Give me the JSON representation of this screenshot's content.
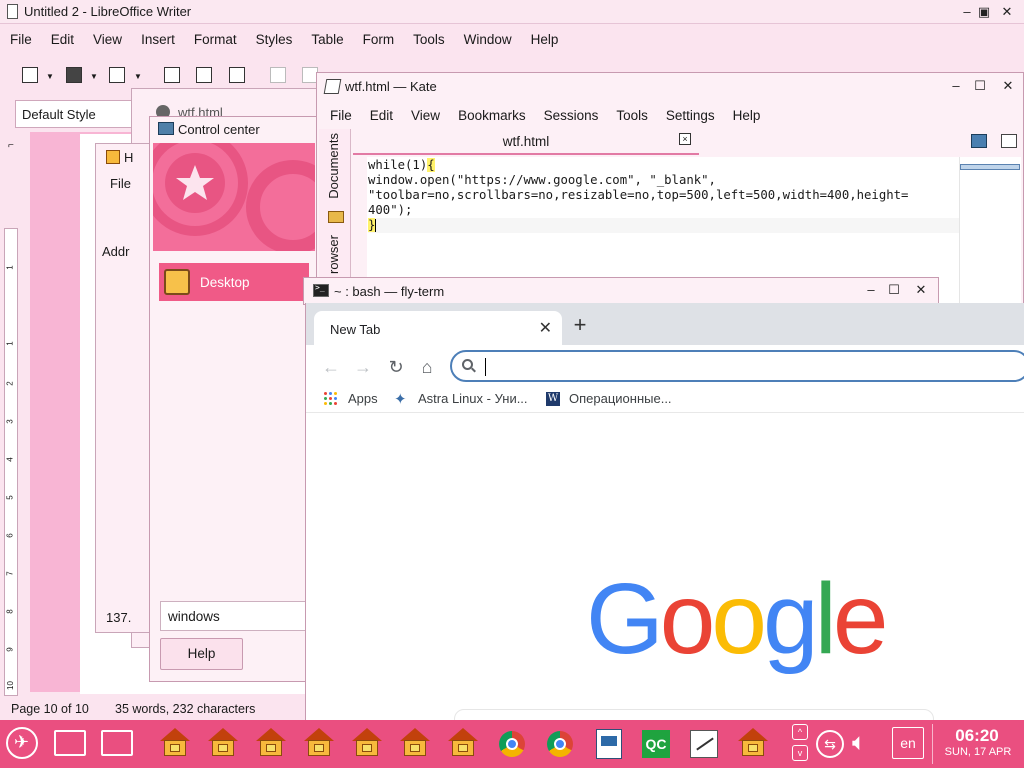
{
  "writer": {
    "title": "Untitled 2 - LibreOffice Writer",
    "menu": [
      "File",
      "Edit",
      "View",
      "Insert",
      "Format",
      "Styles",
      "Table",
      "Form",
      "Tools",
      "Window",
      "Help"
    ],
    "paragraph_style": "Default Style",
    "status": {
      "page": "Page 10 of 10",
      "words": "35 words, 232 characters"
    },
    "ruler_numbers": [
      "1",
      "1",
      "2",
      "3",
      "4",
      "5",
      "6",
      "7",
      "8",
      "9",
      "10"
    ]
  },
  "behind_windows": {
    "wtf_title": "wtf.html",
    "fm_title": "H",
    "fm_file": "File",
    "fm_addr": "Addr",
    "fm_status": "137."
  },
  "control_center": {
    "title": "Control center",
    "selected_item": "Desktop",
    "search_value": "windows",
    "help_label": "Help"
  },
  "kate": {
    "title": "wtf.html  — Kate",
    "menu": [
      "File",
      "Edit",
      "View",
      "Bookmarks",
      "Sessions",
      "Tools",
      "Settings",
      "Help"
    ],
    "side_tabs": [
      "Documents",
      "rowser"
    ],
    "tab_label": "wtf.html",
    "code": [
      "while(1){",
      "window.open(\"https://www.google.com\", \"_blank\",",
      "\"toolbar=no,scrollbars=no,resizable=no,top=500,left=500,width=400,height=",
      "400\");",
      "}"
    ]
  },
  "terminal": {
    "title": "~ : bash — fly-term"
  },
  "chrome": {
    "tab_label": "New Tab",
    "omnibox_value": "",
    "bookmarks": [
      "Apps",
      "Astra Linux - Уни...",
      "Операционные..."
    ],
    "logo_letters": [
      "G",
      "o",
      "o",
      "g",
      "l",
      "e"
    ],
    "logo_colors": [
      "#4285F4",
      "#EA4335",
      "#FBBC05",
      "#4285F4",
      "#34A853",
      "#EA4335"
    ]
  },
  "taskbar": {
    "color": "#ea4f80",
    "language": "en",
    "time": "06:20",
    "date": "SUN, 17 APR"
  }
}
